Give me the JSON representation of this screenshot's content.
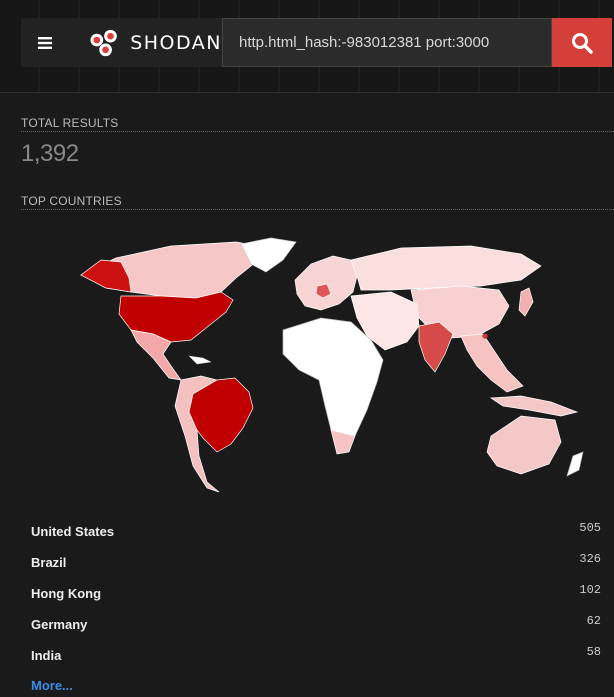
{
  "header": {
    "logo_text": "SHODAN",
    "search_value": "http.html_hash:-983012381 port:3000",
    "colors": {
      "accent": "#d43f3a",
      "bar_bg": "#161616"
    },
    "icons": {
      "menu": "hamburger-icon",
      "search": "search-icon",
      "logo": "shodan-logo-icon"
    }
  },
  "total_results": {
    "label": "TOTAL RESULTS",
    "value": "1,392"
  },
  "top_countries": {
    "label": "TOP COUNTRIES",
    "items": [
      {
        "name": "United States",
        "count": "505"
      },
      {
        "name": "Brazil",
        "count": "326"
      },
      {
        "name": "Hong Kong",
        "count": "102"
      },
      {
        "name": "Germany",
        "count": "62"
      },
      {
        "name": "India",
        "count": "58"
      }
    ],
    "more_label": "More..."
  }
}
